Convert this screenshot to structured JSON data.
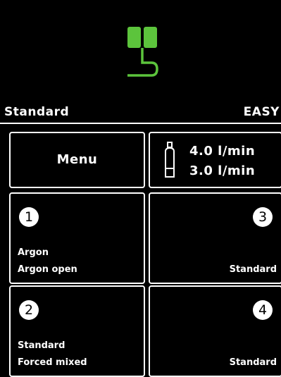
{
  "colors": {
    "accent": "#5cc43c",
    "background": "#000000",
    "foreground": "#ffffff"
  },
  "logo": {
    "icon": "torch-connector-icon"
  },
  "header": {
    "mode": "Standard",
    "level": "EASY"
  },
  "menu": {
    "label": "Menu"
  },
  "gas": {
    "icon": "gas-bottle-icon",
    "flow_set": "4.0 l/min",
    "flow_actual": "3.0 l/min"
  },
  "programs": [
    {
      "number": "1",
      "line1": "Argon",
      "line2": "Argon open"
    },
    {
      "number": "3",
      "line1": "",
      "line2": "Standard"
    },
    {
      "number": "2",
      "line1": "Standard",
      "line2": "Forced mixed"
    },
    {
      "number": "4",
      "line1": "",
      "line2": "Standard"
    }
  ]
}
